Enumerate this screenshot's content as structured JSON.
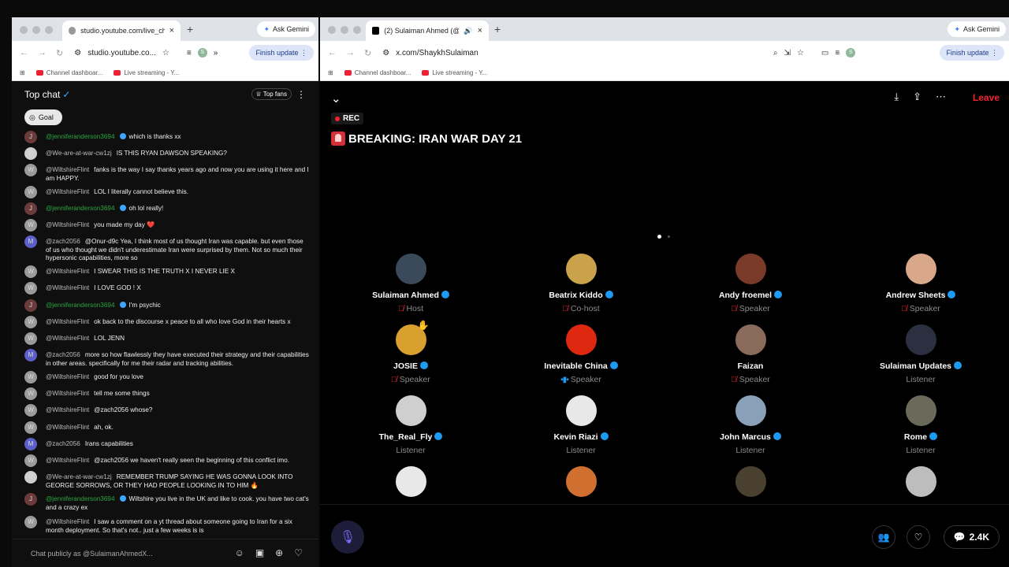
{
  "left_window": {
    "tab_title": "studio.youtube.com/live_chat",
    "ask_gemini": "Ask Gemini",
    "url": "studio.youtube.co...",
    "finish_update": "Finish update",
    "profile_initial": "S",
    "bookmarks": [
      "Channel dashboar...",
      "Live streaming - Y..."
    ],
    "chat": {
      "title": "Top chat",
      "top_fans": "Top fans",
      "goal": "Goal",
      "input_placeholder": "Chat publicly as @SulaimanAhmedX...",
      "messages": [
        {
          "avatar": "J",
          "author": "@jenniferanderson3694",
          "member": true,
          "text": "which is thanks xx"
        },
        {
          "avatar": "R",
          "author": "@We-are-at-war-cw1zj",
          "member": false,
          "text": "IS THIS RYAN DAWSON SPEAKING?"
        },
        {
          "avatar": "W",
          "author": "@WiltshireFlint",
          "member": false,
          "text": "fanks is the way I say thanks years ago and now you are using it here and I am HAPPY."
        },
        {
          "avatar": "W",
          "author": "@WiltshireFlint",
          "member": false,
          "text": "LOL I literally cannot believe this."
        },
        {
          "avatar": "J",
          "author": "@jenniferanderson3694",
          "member": true,
          "text": "oh lol really!"
        },
        {
          "avatar": "W",
          "author": "@WiltshireFlint",
          "member": false,
          "text": "you made my day ❤️"
        },
        {
          "avatar": "M",
          "author": "@zach2056",
          "member": false,
          "text": "@Onur-d9c Yea, I think most of us thought Iran was capable. but even those of us who thought we didn't underestimate Iran were surprised by them. Not so much their hypersonic capabilities, more so"
        },
        {
          "avatar": "W",
          "author": "@WiltshireFlint",
          "member": false,
          "text": "I SWEAR THIS IS THE TRUTH X I NEVER LIE X"
        },
        {
          "avatar": "W",
          "author": "@WiltshireFlint",
          "member": false,
          "text": "I LOVE GOD ! X"
        },
        {
          "avatar": "J",
          "author": "@jenniferanderson3694",
          "member": true,
          "text": "I'm psychic"
        },
        {
          "avatar": "W",
          "author": "@WiltshireFlint",
          "member": false,
          "text": "ok back to the discourse x peace to all who love God in their hearts x"
        },
        {
          "avatar": "W",
          "author": "@WiltshireFlint",
          "member": false,
          "text": "LOL JENN"
        },
        {
          "avatar": "M",
          "author": "@zach2056",
          "member": false,
          "text": "more so how flawlessly they have executed their strategy and their capabilities in other areas. specifically for me their radar and tracking abilities."
        },
        {
          "avatar": "W",
          "author": "@WiltshireFlint",
          "member": false,
          "text": "good for you love"
        },
        {
          "avatar": "W",
          "author": "@WiltshireFlint",
          "member": false,
          "text": "tell me some things"
        },
        {
          "avatar": "W",
          "author": "@WiltshireFlint",
          "member": false,
          "text": "@zach2056 whose?"
        },
        {
          "avatar": "W",
          "author": "@WiltshireFlint",
          "member": false,
          "text": "ah, ok."
        },
        {
          "avatar": "M",
          "author": "@zach2056",
          "member": false,
          "text": "Irans capabilities"
        },
        {
          "avatar": "W",
          "author": "@WiltshireFlint",
          "member": false,
          "text": "@zach2056 we haven't really seen the beginning of this conflict imo."
        },
        {
          "avatar": "R",
          "author": "@We-are-at-war-cw1zj",
          "member": false,
          "text": "REMEMBER TRUMP SAYING HE WAS GONNA LOOK INTO GEORGE SORROWS, OR THEY HAD PEOPLE LOOKING IN TO HIM 🔥"
        },
        {
          "avatar": "J",
          "author": "@jenniferanderson3694",
          "member": true,
          "text": "Wiltshire you live in the UK and like to cook. you have two cat's and a crazy ex"
        },
        {
          "avatar": "W",
          "author": "@WiltshireFlint",
          "member": false,
          "text": "I saw a comment on a yt thread about someone going to Iran for a six month deployment. So that's not.. just a few weeks is is"
        }
      ]
    }
  },
  "right_window": {
    "tab_title": "(2) Sulaiman Ahmed (@S",
    "ask_gemini": "Ask Gemini",
    "url": "x.com/ShaykhSulaiman",
    "finish_update": "Finish update",
    "profile_initial": "S",
    "bookmarks": [
      "Channel dashboar...",
      "Live streaming - Y..."
    ],
    "space": {
      "leave": "Leave",
      "rec": "REC",
      "title": "BREAKING: IRAN WAR DAY 21",
      "listener_count": "2.4K",
      "participants": [
        {
          "name": "Sulaiman Ahmed",
          "role": "Host",
          "verified": true,
          "muted": true,
          "color": "#3a4a5a"
        },
        {
          "name": "Beatrix Kiddo",
          "role": "Co-host",
          "verified": true,
          "muted": true,
          "color": "#c9a24a"
        },
        {
          "name": "Andy froemel",
          "role": "Speaker",
          "verified": true,
          "muted": true,
          "color": "#7a3a2a"
        },
        {
          "name": "Andrew Sheets",
          "role": "Speaker",
          "verified": true,
          "muted": true,
          "color": "#d9a88a"
        },
        {
          "name": "JOSIE",
          "role": "Speaker",
          "verified": true,
          "muted": true,
          "color": "#d9a030"
        },
        {
          "name": "Inevitable China",
          "role": "Speaker",
          "verified": true,
          "muted": false,
          "color": "#de2910"
        },
        {
          "name": "Faizan",
          "role": "Speaker",
          "verified": false,
          "muted": true,
          "color": "#8a6a5a"
        },
        {
          "name": "Sulaiman Updates",
          "role": "Listener",
          "verified": true,
          "muted": false,
          "color": "#2a3040"
        },
        {
          "name": "The_Real_Fly",
          "role": "Listener",
          "verified": true,
          "muted": false,
          "color": "#cfcfcf"
        },
        {
          "name": "Kevin Riazi",
          "role": "Listener",
          "verified": true,
          "muted": false,
          "color": "#e8e8e8"
        },
        {
          "name": "John Marcus",
          "role": "Listener",
          "verified": true,
          "muted": false,
          "color": "#8aa0b8"
        },
        {
          "name": "Rome",
          "role": "Listener",
          "verified": true,
          "muted": false,
          "color": "#6a6a5a"
        },
        {
          "name": "",
          "role": "",
          "verified": false,
          "muted": false,
          "color": "#e8e8e8"
        },
        {
          "name": "",
          "role": "",
          "verified": false,
          "muted": false,
          "color": "#d07030"
        },
        {
          "name": "",
          "role": "",
          "verified": false,
          "muted": false,
          "color": "#4a4030"
        },
        {
          "name": "",
          "role": "",
          "verified": false,
          "muted": false,
          "color": "#bdbdbd"
        }
      ]
    }
  }
}
